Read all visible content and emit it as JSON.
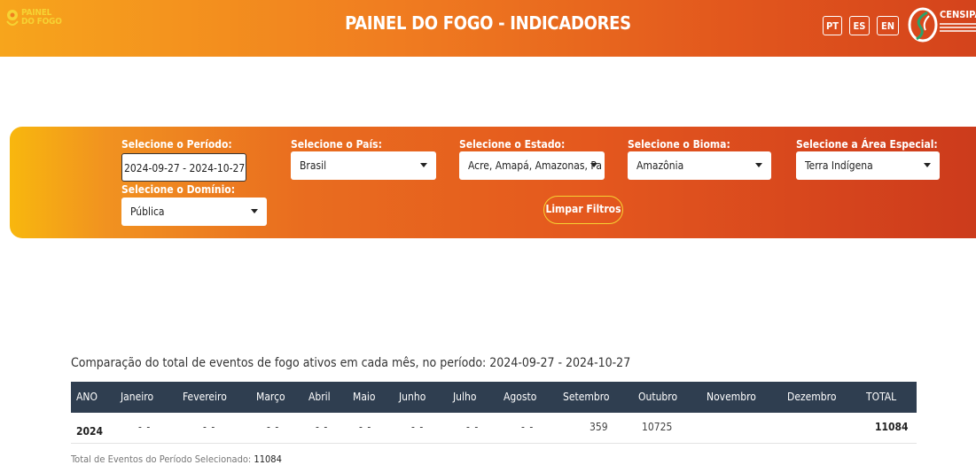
{
  "header": {
    "logo_line1": "PAINEL",
    "logo_line2": "DO FOGO",
    "title": "PAINEL DO FOGO - INDICADORES",
    "languages": [
      "PT",
      "ES",
      "EN"
    ],
    "partner": "CENSIPAM",
    "colors": {
      "logo_yellow": "#f6d233",
      "header_start": "#f7a51c",
      "header_end": "#d4431c"
    }
  },
  "filters": {
    "periodo": {
      "label": "Selecione o Período:",
      "value": "2024-09-27 - 2024-10-27"
    },
    "pais": {
      "label": "Selecione o País:",
      "value": "Brasil"
    },
    "estado": {
      "label": "Selecione o Estado:",
      "value": "Acre, Amapá, Amazonas, Pa"
    },
    "bioma": {
      "label": "Selecione o Bioma:",
      "value": "Amazônia"
    },
    "area": {
      "label": "Selecione a Área Especial:",
      "value": "Terra Indígena"
    },
    "dominio": {
      "label": "Selecione o Domínio:",
      "value": "Pública"
    },
    "clear_label": "Limpar Filtros"
  },
  "table": {
    "caption": "Comparação do total de eventos de fogo ativos em cada mês, no período: 2024-09-27 - 2024-10-27",
    "headers": [
      "ANO",
      "Janeiro",
      "Fevereiro",
      "Março",
      "Abril",
      "Maio",
      "Junho",
      "Julho",
      "Agosto",
      "Setembro",
      "Outubro",
      "Novembro",
      "Dezembro",
      "TOTAL"
    ],
    "rows": [
      {
        "ano": "2024",
        "cells": [
          "- -",
          "- -",
          "- -",
          "- -",
          "- -",
          "- -",
          "- -",
          "- -",
          "359",
          "10725",
          "",
          "",
          "11084"
        ]
      }
    ],
    "footer_label": "Total de Eventos do Período Selecionado:",
    "footer_value": "11084"
  }
}
